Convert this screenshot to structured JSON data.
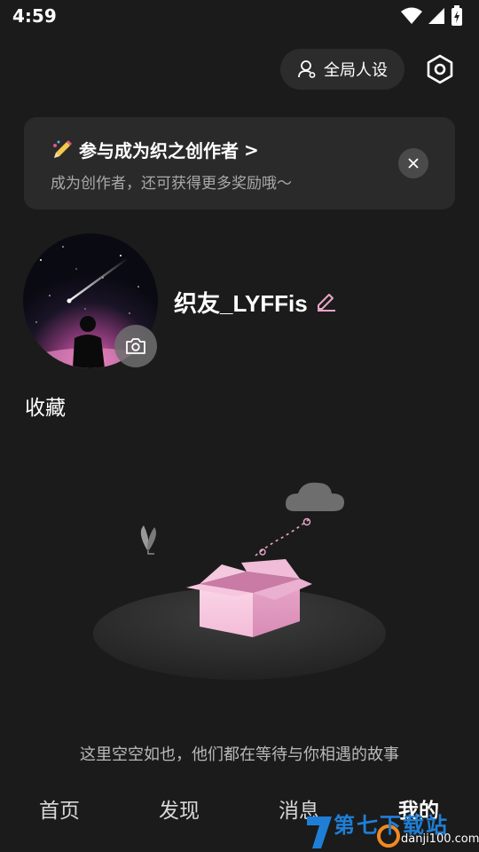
{
  "status_bar": {
    "time": "4:59"
  },
  "header": {
    "persona_label": "全局人设"
  },
  "banner": {
    "title": "参与成为织之创作者",
    "title_arrow": ">",
    "subtitle": "成为创作者，还可获得更多奖励哦～"
  },
  "profile": {
    "username": "织友_LYFFis"
  },
  "collection": {
    "title": "收藏",
    "empty_text": "这里空空如也，他们都在等待与你相遇的故事"
  },
  "nav": {
    "items": [
      {
        "label": "首页"
      },
      {
        "label": "发现"
      },
      {
        "label": "消息"
      },
      {
        "label": "我的"
      }
    ]
  },
  "watermark": {
    "brand": "第七下载站",
    "domain": "danji100.com"
  },
  "colors": {
    "background": "#1b1b1b",
    "card": "#2a2a2a",
    "accent_pink": "#e9a6c9"
  }
}
